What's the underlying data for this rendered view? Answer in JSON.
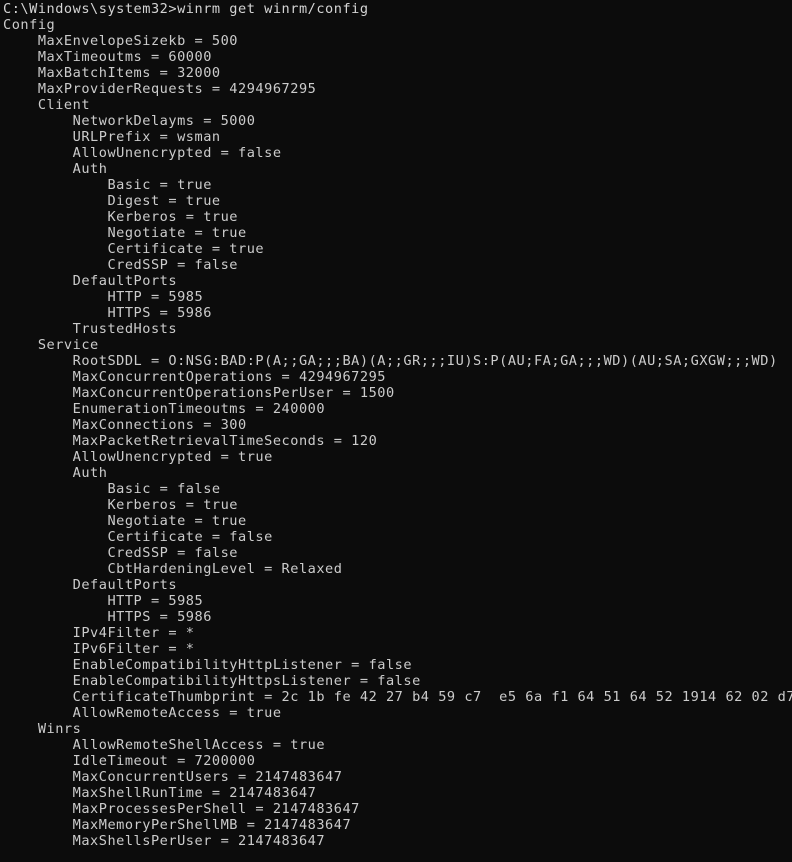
{
  "terminal": {
    "window_kind": "windows-command-prompt",
    "background_color": "#0c0c0c",
    "text_color": "#cccccc",
    "prompt": "C:\\Windows\\system32>",
    "command": "winrm get winrm/config",
    "prompt_line": "C:\\Windows\\system32>winrm get winrm/config",
    "lines": [
      "C:\\Windows\\system32>winrm get winrm/config",
      "Config",
      "    MaxEnvelopeSizekb = 500",
      "    MaxTimeoutms = 60000",
      "    MaxBatchItems = 32000",
      "    MaxProviderRequests = 4294967295",
      "    Client",
      "        NetworkDelayms = 5000",
      "        URLPrefix = wsman",
      "        AllowUnencrypted = false",
      "        Auth",
      "            Basic = true",
      "            Digest = true",
      "            Kerberos = true",
      "            Negotiate = true",
      "            Certificate = true",
      "            CredSSP = false",
      "        DefaultPorts",
      "            HTTP = 5985",
      "            HTTPS = 5986",
      "        TrustedHosts",
      "    Service",
      "        RootSDDL = O:NSG:BAD:P(A;;GA;;;BA)(A;;GR;;;IU)S:P(AU;FA;GA;;;WD)(AU;SA;GXGW;;;WD)",
      "        MaxConcurrentOperations = 4294967295",
      "        MaxConcurrentOperationsPerUser = 1500",
      "        EnumerationTimeoutms = 240000",
      "        MaxConnections = 300",
      "        MaxPacketRetrievalTimeSeconds = 120",
      "        AllowUnencrypted = true",
      "        Auth",
      "            Basic = false",
      "            Kerberos = true",
      "            Negotiate = true",
      "            Certificate = false",
      "            CredSSP = false",
      "            CbtHardeningLevel = Relaxed",
      "        DefaultPorts",
      "            HTTP = 5985",
      "            HTTPS = 5986",
      "        IPv4Filter = *",
      "        IPv6Filter = *",
      "        EnableCompatibilityHttpListener = false",
      "        EnableCompatibilityHttpsListener = false",
      "        CertificateThumbprint = 2c 1b fe 42 27 b4 59 c7  e5 6a f1 64 51 64 52 1914 62 02 d7",
      "        AllowRemoteAccess = true",
      "    Winrs",
      "        AllowRemoteShellAccess = true",
      "        IdleTimeout = 7200000",
      "        MaxConcurrentUsers = 2147483647",
      "        MaxShellRunTime = 2147483647",
      "        MaxProcessesPerShell = 2147483647",
      "        MaxMemoryPerShellMB = 2147483647",
      "        MaxShellsPerUser = 2147483647"
    ],
    "config": {
      "root": "Config",
      "MaxEnvelopeSizekb": "500",
      "MaxTimeoutms": "60000",
      "MaxBatchItems": "32000",
      "MaxProviderRequests": "4294967295",
      "Client": {
        "NetworkDelayms": "5000",
        "URLPrefix": "wsman",
        "AllowUnencrypted": "false",
        "Auth": {
          "Basic": "true",
          "Digest": "true",
          "Kerberos": "true",
          "Negotiate": "true",
          "Certificate": "true",
          "CredSSP": "false"
        },
        "DefaultPorts": {
          "HTTP": "5985",
          "HTTPS": "5986"
        },
        "TrustedHosts": ""
      },
      "Service": {
        "RootSDDL": "O:NSG:BAD:P(A;;GA;;;BA)(A;;GR;;;IU)S:P(AU;FA;GA;;;WD)(AU;SA;GXGW;;;WD)",
        "MaxConcurrentOperations": "4294967295",
        "MaxConcurrentOperationsPerUser": "1500",
        "EnumerationTimeoutms": "240000",
        "MaxConnections": "300",
        "MaxPacketRetrievalTimeSeconds": "120",
        "AllowUnencrypted": "true",
        "Auth": {
          "Basic": "false",
          "Kerberos": "true",
          "Negotiate": "true",
          "Certificate": "false",
          "CredSSP": "false",
          "CbtHardeningLevel": "Relaxed"
        },
        "DefaultPorts": {
          "HTTP": "5985",
          "HTTPS": "5986"
        },
        "IPv4Filter": "*",
        "IPv6Filter": "*",
        "EnableCompatibilityHttpListener": "false",
        "EnableCompatibilityHttpsListener": "false",
        "CertificateThumbprint": "2c 1b fe 42 27 b4 59 c7  e5 6a f1 64 51 64 52 1914 62 02 d7",
        "AllowRemoteAccess": "true"
      },
      "Winrs": {
        "AllowRemoteShellAccess": "true",
        "IdleTimeout": "7200000",
        "MaxConcurrentUsers": "2147483647",
        "MaxShellRunTime": "2147483647",
        "MaxProcessesPerShell": "2147483647",
        "MaxMemoryPerShellMB": "2147483647",
        "MaxShellsPerUser": "2147483647"
      }
    }
  }
}
